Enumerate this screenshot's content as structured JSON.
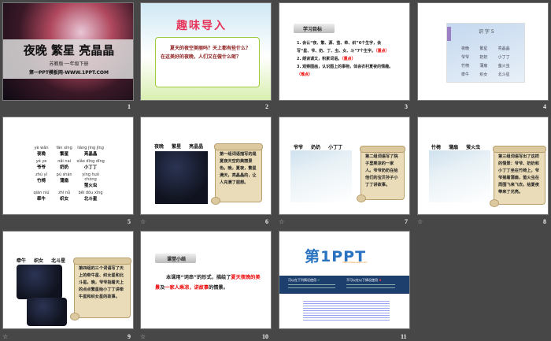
{
  "slides": [
    {
      "number": "1",
      "title": "夜晚 繁星 亮晶晶",
      "subtitle": "苏教版·一年级下册",
      "site": "第一PPT模板网-WWW.1PPT.COM"
    },
    {
      "number": "2",
      "heading": "趣味导入",
      "body": "夏天的夜空美丽吗？天上都有些什么？在这美好的夜晚，人们又在做什么呢？"
    },
    {
      "number": "3",
      "heading": "学习目标",
      "items": [
        "1. 会认“夜、繁、源、萤、牵、织”6个生字，会写“星、爷、奶、丁、虫、女、斗”7个生字。",
        "（重点）",
        "2. 朗读课文，积累词语。",
        "（重点）",
        "3. 观察图画，认识图上的事物，体会农村夏夜的情趣。",
        "（难点）"
      ]
    },
    {
      "number": "4",
      "heading": "识 字 5",
      "words": [
        "夜晚",
        "繁星",
        "亮晶晶",
        "爷爷",
        "奶奶",
        "小丁丁",
        "竹椅",
        "蒲扇",
        "萤火虫",
        "牵牛",
        "织女",
        "北斗星"
      ]
    },
    {
      "number": "5",
      "pinyin": [
        "yè wǎn",
        "fán xīng",
        "liàng jīng jīng",
        "yé ye",
        "nǎi nai",
        "xiǎo dīng dīng",
        "zhú yǐ",
        "pú shàn",
        "yíng huǒ chóng",
        "qiān niú",
        "zhī nǚ",
        "běi dǒu xīng"
      ],
      "words": [
        "夜晚",
        "繁星",
        "亮晶晶",
        "爷爷",
        "奶奶",
        "小丁丁",
        "竹椅",
        "蒲扇",
        "萤火虫",
        "牵牛",
        "织女",
        "北斗星"
      ]
    },
    {
      "number": "6",
      "label": "夜晚 繁星 亮晶晶",
      "scroll": "第一组词语描写的是夏夜天空的美丽景色。晚，夏夜，繁星满天，亮晶晶的，让人充满了遐想。"
    },
    {
      "number": "7",
      "label": "爷爷 奶奶 小丁丁",
      "scroll": "第二组词语写了院子里乘凉的一家人。爷爷奶奶在给他们的宝贝孙子小丁丁讲故事。"
    },
    {
      "number": "8",
      "label": "竹椅 蒲扇 萤火虫",
      "scroll": "第三组词语写出了这样的情景：爷爷、奶奶和小丁丁坐在竹椅上，爷爷摇着蒲扇，萤火虫在周围飞来飞去，给夏夜带来了光亮。"
    },
    {
      "number": "9",
      "label": "牵牛 织女 北斗星",
      "scroll": "第四组的三个词语写了天上的牵牛星、织女星和北斗星。晚，爷爷指着天上的点点繁星给小丁丁讲牵牛星和织女星的故事。"
    },
    {
      "number": "10",
      "heading": "课堂小结",
      "text_a": "本课用“词串”的形式，描绘了",
      "red_a": "夏天夜晚的美景",
      "text_b": "及",
      "red_b": "一家人乘凉，讲故事",
      "text_c": "的情景。"
    },
    {
      "number": "11",
      "logo": "第1PPT",
      "url": "http://www.1ppt.com",
      "can_use": "可以在下列情况使用",
      "cannot_use": "不可以在以下情况使用"
    }
  ],
  "anim_icon": "☆"
}
